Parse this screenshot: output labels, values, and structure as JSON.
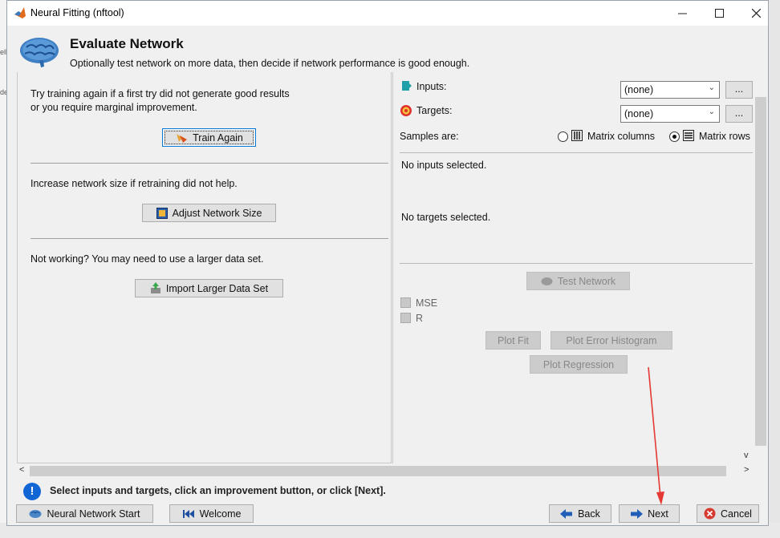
{
  "window": {
    "title": "Neural Fitting (nftool)",
    "controls": {
      "minimize": "—",
      "maximize": "☐",
      "close": "✕"
    }
  },
  "header": {
    "title": "Evaluate Network",
    "subtitle": "Optionally test network on more data, then decide if network performance is good enough."
  },
  "left_panel": {
    "section1_line1": "Try training again if a first try did not generate good results",
    "section1_line2": "or you require marginal improvement.",
    "train_again_label": "Train Again",
    "section2_text": "Increase network size if retraining did not help.",
    "adjust_size_label": "Adjust Network Size",
    "section3_text": "Not working? You may need to use a larger data set.",
    "import_label": "Import Larger Data Set"
  },
  "right_panel": {
    "inputs_label": "Inputs:",
    "inputs_value": "(none)",
    "targets_label": "Targets:",
    "targets_value": "(none)",
    "browse_label": "...",
    "samples_label": "Samples are:",
    "matrix_columns_label": "Matrix columns",
    "matrix_rows_label": "Matrix rows",
    "samples_selected": "Matrix rows",
    "no_inputs_text": "No inputs selected.",
    "no_targets_text": "No targets selected.",
    "test_network_label": "Test Network",
    "mse_label": "MSE",
    "r_label": "R",
    "plot_fit_label": "Plot Fit",
    "plot_error_hist_label": "Plot Error Histogram",
    "plot_regression_label": "Plot Regression"
  },
  "scroll": {
    "left_arrow": "<",
    "right_arrow": ">",
    "down_arrow": "v"
  },
  "status": {
    "icon": "!",
    "message": "Select inputs and targets, click an improvement button, or click [Next]."
  },
  "footer": {
    "nn_start_label": "Neural Network Start",
    "welcome_label": "Welcome",
    "back_label": "Back",
    "next_label": "Next",
    "cancel_label": "Cancel"
  },
  "background_fragments": [
    "ell",
    "de"
  ],
  "annotation": {
    "type": "arrow",
    "color": "#e53935",
    "target": "next-button"
  }
}
